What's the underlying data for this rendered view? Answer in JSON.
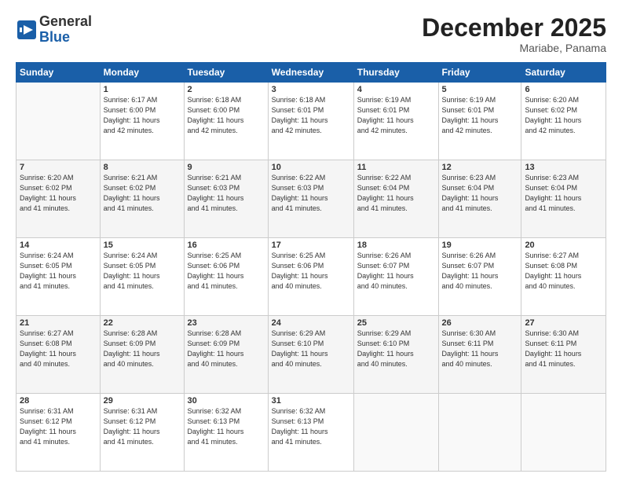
{
  "logo": {
    "general": "General",
    "blue": "Blue"
  },
  "title": {
    "month": "December 2025",
    "location": "Mariabe, Panama"
  },
  "header_days": [
    "Sunday",
    "Monday",
    "Tuesday",
    "Wednesday",
    "Thursday",
    "Friday",
    "Saturday"
  ],
  "weeks": [
    [
      {
        "day": "",
        "info": ""
      },
      {
        "day": "1",
        "info": "Sunrise: 6:17 AM\nSunset: 6:00 PM\nDaylight: 11 hours\nand 42 minutes."
      },
      {
        "day": "2",
        "info": "Sunrise: 6:18 AM\nSunset: 6:00 PM\nDaylight: 11 hours\nand 42 minutes."
      },
      {
        "day": "3",
        "info": "Sunrise: 6:18 AM\nSunset: 6:01 PM\nDaylight: 11 hours\nand 42 minutes."
      },
      {
        "day": "4",
        "info": "Sunrise: 6:19 AM\nSunset: 6:01 PM\nDaylight: 11 hours\nand 42 minutes."
      },
      {
        "day": "5",
        "info": "Sunrise: 6:19 AM\nSunset: 6:01 PM\nDaylight: 11 hours\nand 42 minutes."
      },
      {
        "day": "6",
        "info": "Sunrise: 6:20 AM\nSunset: 6:02 PM\nDaylight: 11 hours\nand 42 minutes."
      }
    ],
    [
      {
        "day": "7",
        "info": "Sunrise: 6:20 AM\nSunset: 6:02 PM\nDaylight: 11 hours\nand 41 minutes."
      },
      {
        "day": "8",
        "info": "Sunrise: 6:21 AM\nSunset: 6:02 PM\nDaylight: 11 hours\nand 41 minutes."
      },
      {
        "day": "9",
        "info": "Sunrise: 6:21 AM\nSunset: 6:03 PM\nDaylight: 11 hours\nand 41 minutes."
      },
      {
        "day": "10",
        "info": "Sunrise: 6:22 AM\nSunset: 6:03 PM\nDaylight: 11 hours\nand 41 minutes."
      },
      {
        "day": "11",
        "info": "Sunrise: 6:22 AM\nSunset: 6:04 PM\nDaylight: 11 hours\nand 41 minutes."
      },
      {
        "day": "12",
        "info": "Sunrise: 6:23 AM\nSunset: 6:04 PM\nDaylight: 11 hours\nand 41 minutes."
      },
      {
        "day": "13",
        "info": "Sunrise: 6:23 AM\nSunset: 6:04 PM\nDaylight: 11 hours\nand 41 minutes."
      }
    ],
    [
      {
        "day": "14",
        "info": "Sunrise: 6:24 AM\nSunset: 6:05 PM\nDaylight: 11 hours\nand 41 minutes."
      },
      {
        "day": "15",
        "info": "Sunrise: 6:24 AM\nSunset: 6:05 PM\nDaylight: 11 hours\nand 41 minutes."
      },
      {
        "day": "16",
        "info": "Sunrise: 6:25 AM\nSunset: 6:06 PM\nDaylight: 11 hours\nand 41 minutes."
      },
      {
        "day": "17",
        "info": "Sunrise: 6:25 AM\nSunset: 6:06 PM\nDaylight: 11 hours\nand 40 minutes."
      },
      {
        "day": "18",
        "info": "Sunrise: 6:26 AM\nSunset: 6:07 PM\nDaylight: 11 hours\nand 40 minutes."
      },
      {
        "day": "19",
        "info": "Sunrise: 6:26 AM\nSunset: 6:07 PM\nDaylight: 11 hours\nand 40 minutes."
      },
      {
        "day": "20",
        "info": "Sunrise: 6:27 AM\nSunset: 6:08 PM\nDaylight: 11 hours\nand 40 minutes."
      }
    ],
    [
      {
        "day": "21",
        "info": "Sunrise: 6:27 AM\nSunset: 6:08 PM\nDaylight: 11 hours\nand 40 minutes."
      },
      {
        "day": "22",
        "info": "Sunrise: 6:28 AM\nSunset: 6:09 PM\nDaylight: 11 hours\nand 40 minutes."
      },
      {
        "day": "23",
        "info": "Sunrise: 6:28 AM\nSunset: 6:09 PM\nDaylight: 11 hours\nand 40 minutes."
      },
      {
        "day": "24",
        "info": "Sunrise: 6:29 AM\nSunset: 6:10 PM\nDaylight: 11 hours\nand 40 minutes."
      },
      {
        "day": "25",
        "info": "Sunrise: 6:29 AM\nSunset: 6:10 PM\nDaylight: 11 hours\nand 40 minutes."
      },
      {
        "day": "26",
        "info": "Sunrise: 6:30 AM\nSunset: 6:11 PM\nDaylight: 11 hours\nand 40 minutes."
      },
      {
        "day": "27",
        "info": "Sunrise: 6:30 AM\nSunset: 6:11 PM\nDaylight: 11 hours\nand 41 minutes."
      }
    ],
    [
      {
        "day": "28",
        "info": "Sunrise: 6:31 AM\nSunset: 6:12 PM\nDaylight: 11 hours\nand 41 minutes."
      },
      {
        "day": "29",
        "info": "Sunrise: 6:31 AM\nSunset: 6:12 PM\nDaylight: 11 hours\nand 41 minutes."
      },
      {
        "day": "30",
        "info": "Sunrise: 6:32 AM\nSunset: 6:13 PM\nDaylight: 11 hours\nand 41 minutes."
      },
      {
        "day": "31",
        "info": "Sunrise: 6:32 AM\nSunset: 6:13 PM\nDaylight: 11 hours\nand 41 minutes."
      },
      {
        "day": "",
        "info": ""
      },
      {
        "day": "",
        "info": ""
      },
      {
        "day": "",
        "info": ""
      }
    ]
  ]
}
